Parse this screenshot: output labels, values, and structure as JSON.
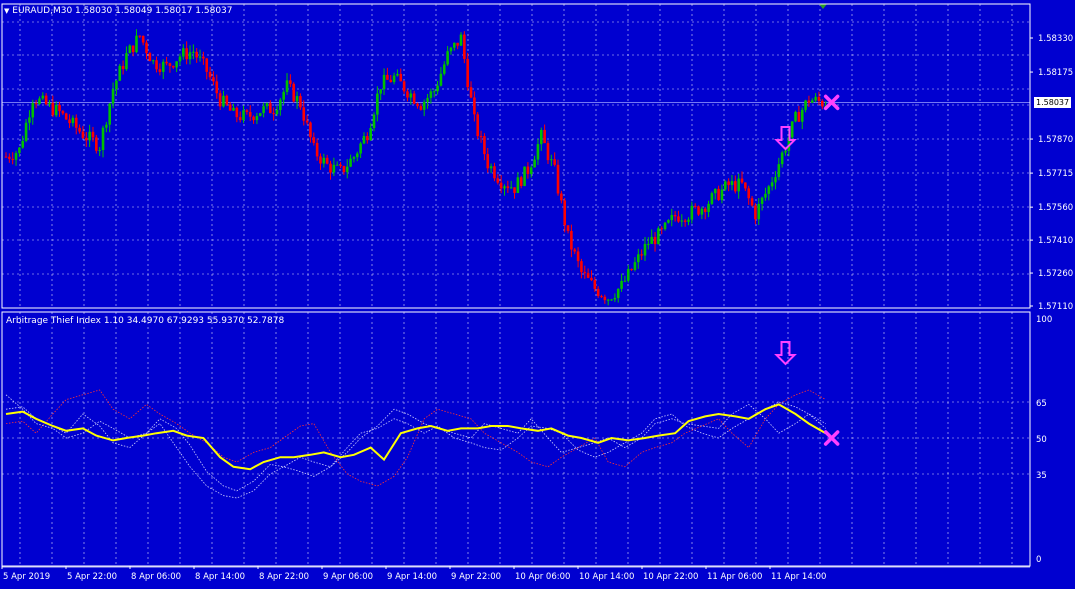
{
  "main": {
    "title": "EURAUD,M30  1.58030 1.58049 1.58017 1.58037",
    "price_axis_ticks": [
      "1.58330",
      "1.58175",
      "1.57870",
      "1.57715",
      "1.57560",
      "1.57410",
      "1.57260",
      "1.57110"
    ],
    "current_price": "1.58037"
  },
  "indicator": {
    "title": "Arbitrage Thief Index 1.10 34.4970 67.9293 55.9370 52.7878",
    "axis_ticks": [
      "100",
      "65",
      "50",
      "35",
      "0"
    ]
  },
  "time_axis": [
    "5 Apr 2019",
    "5 Apr 22:00",
    "8 Apr 06:00",
    "8 Apr 14:00",
    "8 Apr 22:00",
    "9 Apr 06:00",
    "9 Apr 14:00",
    "9 Apr 22:00",
    "10 Apr 06:00",
    "10 Apr 14:00",
    "10 Apr 22:00",
    "11 Apr 06:00",
    "11 Apr 14:00"
  ],
  "colors": {
    "background": "#0000d0",
    "grid": "#ffffff",
    "bull_candle": "#00c000",
    "bear_candle": "#ff0000",
    "main_line": "#ffff00",
    "signal": "#ff40ff"
  },
  "chart_data": [
    {
      "type": "candlestick",
      "symbol": "EURAUD",
      "timeframe": "M30",
      "ylim": [
        1.5705,
        1.5845
      ],
      "close_path": [
        [
          0,
          1.5779
        ],
        [
          4,
          1.5782
        ],
        [
          8,
          1.5806
        ],
        [
          16,
          1.5799
        ],
        [
          24,
          1.5788
        ],
        [
          28,
          1.5784
        ],
        [
          32,
          1.581
        ],
        [
          36,
          1.5825
        ],
        [
          40,
          1.5834
        ],
        [
          44,
          1.5822
        ],
        [
          48,
          1.582
        ],
        [
          52,
          1.5825
        ],
        [
          56,
          1.5827
        ],
        [
          60,
          1.5818
        ],
        [
          64,
          1.5805
        ],
        [
          68,
          1.5798
        ],
        [
          72,
          1.5797
        ],
        [
          76,
          1.58
        ],
        [
          80,
          1.5801
        ],
        [
          84,
          1.5811
        ],
        [
          88,
          1.5803
        ],
        [
          92,
          1.5782
        ],
        [
          96,
          1.5775
        ],
        [
          100,
          1.5772
        ],
        [
          104,
          1.5779
        ],
        [
          108,
          1.579
        ],
        [
          112,
          1.5812
        ],
        [
          116,
          1.5815
        ],
        [
          120,
          1.5809
        ],
        [
          124,
          1.5803
        ],
        [
          128,
          1.5809
        ],
        [
          132,
          1.5825
        ],
        [
          136,
          1.5833
        ],
        [
          140,
          1.5795
        ],
        [
          144,
          1.5776
        ],
        [
          148,
          1.5768
        ],
        [
          152,
          1.5765
        ],
        [
          156,
          1.5773
        ],
        [
          160,
          1.5788
        ],
        [
          164,
          1.5772
        ],
        [
          168,
          1.5742
        ],
        [
          172,
          1.5726
        ],
        [
          176,
          1.5719
        ],
        [
          180,
          1.5715
        ],
        [
          184,
          1.572
        ],
        [
          188,
          1.573
        ],
        [
          192,
          1.574
        ],
        [
          196,
          1.5744
        ],
        [
          200,
          1.5752
        ],
        [
          204,
          1.5753
        ],
        [
          208,
          1.5756
        ],
        [
          212,
          1.5761
        ],
        [
          216,
          1.5766
        ],
        [
          220,
          1.5766
        ],
        [
          224,
          1.5753
        ],
        [
          228,
          1.5765
        ],
        [
          232,
          1.578
        ],
        [
          236,
          1.5796
        ],
        [
          240,
          1.5805
        ],
        [
          244,
          1.58037
        ]
      ],
      "markers": [
        {
          "kind": "sell-arrow",
          "bar": 233,
          "price": 1.5787
        },
        {
          "kind": "exit-cross",
          "bar": 245,
          "price": 1.58037
        }
      ]
    },
    {
      "type": "line",
      "name": "Arbitrage Thief Index 1.10",
      "ylim": [
        0,
        100
      ],
      "levels": [
        65,
        50,
        35
      ],
      "bars": 246,
      "series": [
        {
          "name": "34.4970",
          "style": "dotted-white",
          "values": [
            62,
            63,
            58,
            55,
            52,
            60,
            55,
            48,
            46,
            52,
            58,
            54,
            47,
            36,
            30,
            28,
            32,
            39,
            38,
            42,
            40,
            38,
            46,
            52,
            54,
            58,
            56,
            52,
            55,
            50,
            48,
            46,
            45,
            50,
            55,
            54,
            52,
            45,
            42,
            44,
            48,
            52,
            58,
            60,
            55,
            52,
            50,
            54,
            58,
            62,
            65,
            63,
            60,
            56
          ]
        },
        {
          "name": "67.9293",
          "style": "dotted-red",
          "values": [
            56,
            57,
            52,
            60,
            66,
            68,
            70,
            62,
            58,
            64,
            60,
            56,
            52,
            48,
            42,
            40,
            44,
            46,
            50,
            55,
            56,
            44,
            35,
            32,
            30,
            34,
            42,
            58,
            62,
            60,
            58,
            52,
            48,
            44,
            40,
            38,
            42,
            46,
            50,
            40,
            38,
            44,
            46,
            48,
            52,
            55,
            58,
            52,
            46,
            58,
            64,
            68,
            70,
            66
          ]
        },
        {
          "name": "55.9370",
          "style": "dotted-white",
          "values": [
            68,
            62,
            56,
            54,
            50,
            52,
            57,
            54,
            50,
            52,
            56,
            46,
            38,
            30,
            26,
            25,
            28,
            35,
            38,
            36,
            34,
            38,
            44,
            50,
            55,
            62,
            60,
            56,
            54,
            52,
            50,
            56,
            54,
            52,
            58,
            50,
            44,
            46,
            48,
            50,
            46,
            50,
            56,
            58,
            56,
            55,
            54,
            60,
            64,
            58,
            52,
            56,
            60,
            54
          ]
        },
        {
          "name": "52.7878",
          "style": "solid-yellow",
          "values": [
            60,
            61,
            58,
            55,
            53,
            54,
            51,
            49,
            50,
            51,
            52,
            53,
            51,
            50,
            42,
            38,
            37,
            40,
            42,
            42,
            43,
            44,
            42,
            43,
            46,
            41,
            52,
            54,
            55,
            53,
            54,
            54,
            55,
            55,
            54,
            53,
            54,
            51,
            50,
            48,
            50,
            49,
            50,
            51,
            52,
            57,
            59,
            60,
            59,
            58,
            62,
            64,
            60,
            56,
            52
          ]
        }
      ],
      "markers": [
        {
          "kind": "sell-arrow",
          "bar": 233,
          "value": 80
        },
        {
          "kind": "exit-cross",
          "bar": 245,
          "value": 50
        }
      ]
    }
  ]
}
